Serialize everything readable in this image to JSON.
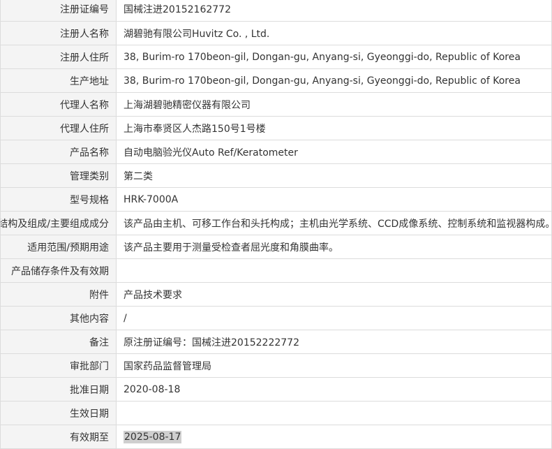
{
  "record": {
    "rows": [
      {
        "label": "注册证编号",
        "value": "国械注进20152162772"
      },
      {
        "label": "注册人名称",
        "value": "湖碧驰有限公司Huvitz Co. , Ltd."
      },
      {
        "label": "注册人住所",
        "value": "38, Burim-ro 170beon-gil, Dongan-gu, Anyang-si, Gyeonggi-do, Republic of Korea"
      },
      {
        "label": "生产地址",
        "value": "38, Burim-ro 170beon-gil, Dongan-gu, Anyang-si, Gyeonggi-do, Republic of Korea"
      },
      {
        "label": "代理人名称",
        "value": "上海湖碧驰精密仪器有限公司"
      },
      {
        "label": "代理人住所",
        "value": "上海市奉贤区人杰路150号1号楼"
      },
      {
        "label": "产品名称",
        "value": "自动电脑验光仪Auto Ref/Keratometer"
      },
      {
        "label": "管理类别",
        "value": "第二类"
      },
      {
        "label": "型号规格",
        "value": "HRK-7000A"
      },
      {
        "label": "结构及组成/主要组成成分",
        "value": "该产品由主机、可移工作台和头托构成；主机由光学系统、CCD成像系统、控制系统和监视器构成。"
      },
      {
        "label": "适用范围/预期用途",
        "value": "该产品主要用于测量受检查者屈光度和角膜曲率。"
      },
      {
        "label": "产品储存条件及有效期",
        "value": ""
      },
      {
        "label": "附件",
        "value": "产品技术要求"
      },
      {
        "label": "其他内容",
        "value": "/"
      },
      {
        "label": "备注",
        "value": "原注册证编号：国械注进20152222772"
      },
      {
        "label": "审批部门",
        "value": "国家药品监督管理局"
      },
      {
        "label": "批准日期",
        "value": "2020-08-18"
      },
      {
        "label": "生效日期",
        "value": ""
      },
      {
        "label": "有效期至",
        "value": "2025-08-17"
      }
    ]
  }
}
